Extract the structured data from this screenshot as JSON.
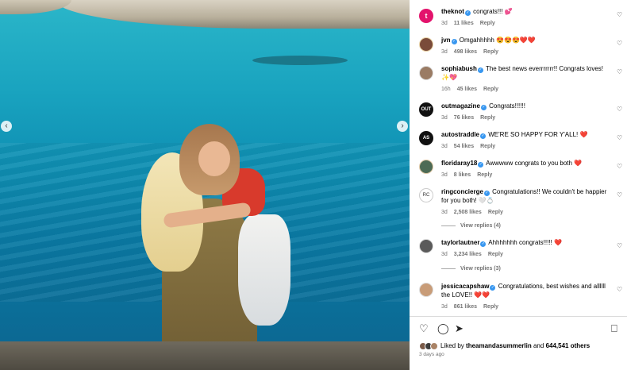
{
  "carousel": {
    "prev_icon": "‹",
    "next_icon": "›"
  },
  "comments": [
    {
      "username": "theknot",
      "text": "congrats!!! 💕",
      "time": "3d",
      "likes": "11 likes",
      "reply": "Reply",
      "avatar_color": "#e3136c",
      "avatar_label": "t"
    },
    {
      "username": "jvn",
      "text": "Omgahhhhh 😍😍😍❤️❤️",
      "time": "3d",
      "likes": "498 likes",
      "reply": "Reply",
      "avatar_color": "#7a4b3a",
      "avatar_label": ""
    },
    {
      "username": "sophiabush",
      "text": "The best news everrrrrrr!! Congrats loves! ✨💖",
      "time": "16h",
      "likes": "45 likes",
      "reply": "Reply",
      "avatar_color": "#9a7b64",
      "avatar_label": ""
    },
    {
      "username": "outmagazine",
      "text": "Congrats!!!!!!",
      "time": "3d",
      "likes": "76 likes",
      "reply": "Reply",
      "avatar_color": "#111111",
      "avatar_label": "OUT"
    },
    {
      "username": "autostraddle",
      "text": "WE'RE SO HAPPY FOR Y'ALL! ❤️",
      "time": "3d",
      "likes": "54 likes",
      "reply": "Reply",
      "avatar_color": "#111111",
      "avatar_label": "AS"
    },
    {
      "username": "floridaray18",
      "text": "Awwwww congrats to you both ❤️",
      "time": "3d",
      "likes": "8 likes",
      "reply": "Reply",
      "avatar_color": "#4d6b55",
      "avatar_label": ""
    },
    {
      "username": "ringconcierge",
      "text": "Congratulations!! We couldn't be happier for you both! 🤍💍",
      "time": "3d",
      "likes": "2,508 likes",
      "reply": "Reply",
      "avatar_color": "#ffffff",
      "avatar_label": "RC",
      "replies": "View replies (4)"
    },
    {
      "username": "taylorlautner",
      "text": "Ahhhhhhh congrats!!!!! ❤️",
      "time": "3d",
      "likes": "3,234 likes",
      "reply": "Reply",
      "avatar_color": "#5a5a5a",
      "avatar_label": "",
      "replies": "View replies (3)"
    },
    {
      "username": "jessicacapshaw",
      "text": "Congratulations, best wishes and allllll the LOVE!! ❤️❤️",
      "time": "3d",
      "likes": "861 likes",
      "reply": "Reply",
      "avatar_color": "#c89c78",
      "avatar_label": ""
    }
  ],
  "actions": {
    "like_icon": "♡",
    "comment_icon": "◯",
    "share_icon": "➤",
    "save_icon": "⎕"
  },
  "liked_by": {
    "prefix": "Liked by",
    "user": "theamandasummerlin",
    "middle": "and",
    "count": "644,541 others"
  },
  "posted": "3 days ago",
  "heart_icon": "♡",
  "colors": {
    "verified": "#3897f0",
    "muted": "#737373",
    "divider": "#dbdbdb"
  }
}
